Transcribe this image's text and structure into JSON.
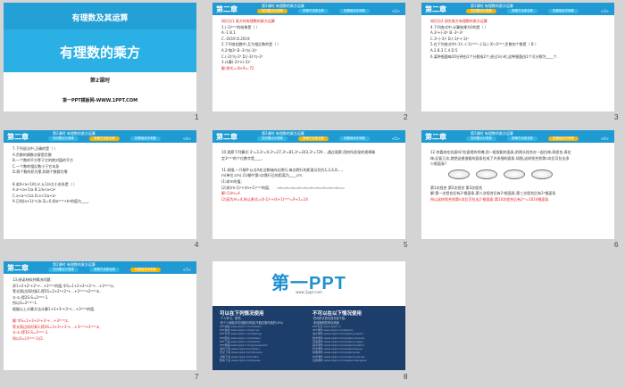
{
  "header": {
    "chapter": "第二章",
    "section": "第2课时 有理数的乘方运算",
    "tabs": [
      "知识要点分类练",
      "规律方法综合练",
      "拓展培优冲刺练"
    ]
  },
  "slides": [
    {
      "number": "1",
      "type": "cover",
      "subtitle": "有理数及其运算",
      "title": "有理数的乘方",
      "lesson": "第2课时",
      "footer": "第一PPT模板网-WWW.1PPT.COM"
    },
    {
      "number": "2",
      "page": "<2>",
      "active_tab": 0,
      "lines": [
        {
          "t": "知识点1  乘方的有理数的乘方运算",
          "red": true
        },
        {
          "t": "1.(-1)²⁰¹⁹的结果是（   ）"
        },
        {
          "t": "A.-1      B.1"
        },
        {
          "t": "C.-2019 D.2019"
        },
        {
          "t": "2.下列各组数中,互为相反数的是（   ）"
        },
        {
          "t": "A.2²和3²            B.-3²与(-3)²"
        },
        {
          "t": "C.(-2)³与-2³   D.(-3)³与-3³"
        },
        {
          "t": "3.计算(-2)³×(-3)²"
        },
        {
          "t": "解:原式=-8×9=-72",
          "red": true
        }
      ]
    },
    {
      "number": "3",
      "page": "<3>",
      "active_tab": 0,
      "lines": [
        {
          "t": "知识点2  研究乘方有理数的乘方运算",
          "red": true
        },
        {
          "t": "4.下列各式中,计算结果为0的是（   ）"
        },
        {
          "t": "A.3²+(-3)²  B.-3²-3²"
        },
        {
          "t": "C.3²-(-3)²  D.(-3)²-(-3)²"
        },
        {
          "t": "5.在下列各式中(-1)²,-(-1)²⁰¹⁹,-|-3|,(-3)²,0²⁰¹⁹,负数的个数是（ B ）"
        },
        {
          "t": "A.2      B.3      C.4      D.5"
        },
        {
          "t": "6.某种细菌每20分钟由1个分裂成2个,经过3小时,这种细菌由1个可分裂为____个."
        }
      ]
    },
    {
      "number": "4",
      "page": "<4>",
      "active_tab": 1,
      "lines": [
        {
          "t": "7.下列说法中,正确的是（   ）"
        },
        {
          "t": "A.负数的偶数次幂是负数"
        },
        {
          "t": "B.一个数的平方等于它的绝对值的平方"
        },
        {
          "t": "C.一个数的相反数小于它本身"
        },
        {
          "t": "D.两个数的积为零,则两个数都为零"
        },
        {
          "t": ""
        },
        {
          "t": "8.若0<a<1时,a²,a,1/a大小关系是（   ）"
        },
        {
          "t": "A.a²<a<1/a            B.1/a<a<a²"
        },
        {
          "t": "C.a<a²<1/a            D.a<1/a<a²"
        },
        {
          "t": "9.已知(a+1)²+|b-2|=0,则a²⁰¹⁹+b³的值为____."
        }
      ]
    },
    {
      "number": "5",
      "page": "<5>",
      "active_tab": 1,
      "lines": [
        {
          "t": "10.观察下列算式:3¹=3,3²=9,3³=27,3⁴=81,3⁵=243,3⁶=729…,通过观察,用你所发现的规律确"
        },
        {
          "t": "定3²⁰¹⁹的个位数字是____."
        },
        {
          "t": ""
        },
        {
          "t": "11.如图,一只蜗牛从点A处沿数轴向右爬行,每次爬行的距离分别为1,2,4,8,…,"
        },
        {
          "t": "m(单位:cm).(1)蜗牛第n次爬行后的距离为____cm."
        },
        {
          "t": "(1)求m的值;"
        },
        {
          "t": "(2)求(m-1)²+(m+1)²⁰¹⁹的值."
        },
        {
          "t": "解:(1)m=4",
          "red": true
        },
        {
          "t": "(2)因为m=4,所以原式=(4-1)²+(4+1)²⁰¹⁹=9+1=14",
          "red": true
        }
      ]
    },
    {
      "number": "6",
      "page": "<6>",
      "active_tab": 2,
      "lines": [
        {
          "t": "12.你喜欢吃拉面吗?拉面馆的师傅,用一根很粗的面条,把两头捏合在一起拉伸,再捏合,再拉"
        },
        {
          "t": "伸,反复几次,就把这根很粗的面条拉成了许多细的面条.如图,这样捏合到第n次后可拉出多"
        },
        {
          "t": "少根面条?"
        },
        {
          "t": ""
        },
        {
          "t": ""
        },
        {
          "t": ""
        },
        {
          "t": "第1次捏合  第2次捏合  第3次捏合"
        },
        {
          "t": "解:第一次捏合后有2¹根面条,第二次捏合后有2²根面条,第三次捏合后有2³根面条"
        },
        {
          "t": "所以这样捏合到第n次后可拉出2ⁿ根面条;第10次捏合后有2¹⁰=1024根面条.",
          "red": true
        }
      ]
    },
    {
      "number": "7",
      "page": "<7>",
      "active_tab": 2,
      "lines": [
        {
          "t": "13.阅读材料并解决问题:"
        },
        {
          "t": "求1+2+2²+2³+…+2²⁰¹⁹的值,令S=1+2+2²+2³+…+2²⁰¹⁹①,"
        },
        {
          "t": "等式两边同时乘2,得2S=2+2²+2³+…+2²⁰¹⁹+2²⁰²⁰②,"
        },
        {
          "t": "②-①,得2S-S=2²⁰²⁰-1."
        },
        {
          "t": "所以S=2²⁰²⁰-1."
        },
        {
          "t": "根据以上计算方法计算1+3+3²+3³+…+3²⁰¹⁹的值."
        },
        {
          "t": ""
        },
        {
          "t": "解:令S=1+3+3²+3³+…+3²⁰¹⁹①,",
          "red": true
        },
        {
          "t": "等式两边同时乘3,得3S=3+3²+3³+…+3²⁰¹⁹+3²⁰²⁰②,",
          "red": true
        },
        {
          "t": "②-①,得3S-S=3²⁰²⁰-1,",
          "red": true
        },
        {
          "t": "所以S=(3²⁰²⁰-1)/2.",
          "red": true
        }
      ]
    },
    {
      "number": "8",
      "type": "ad",
      "logo": "第一PPT",
      "url": "www.1ppt.com",
      "col1": {
        "title": "可以在下列情况使用",
        "desc": [
          "·个人学习、研究;",
          "·在个人网站中引用部分内容(不超过原作品的10%)"
        ],
        "rows": [
          "PPT模板 www.1ppt.com/moban/",
          "PPT素材 www.1ppt.com/sucai/",
          "PPT背景 www.1ppt.com/beijing/",
          "PPT图表 www.1ppt.com/tubiao/",
          "PPT下载 www.1ppt.com/xiazai/",
          "PPT教程 www.1ppt.com/powerpoint/",
          "资料下载 www.1ppt.com/ziliao/",
          "范文下载 www.1ppt.com/fanwen/",
          "试卷下载 www.1ppt.com/shiti/",
          "教案下载 www.1ppt.com/jiaoan/"
        ]
      },
      "col2": {
        "title": "不可以在以下情况使用",
        "desc": [
          "·任何形式的在线付费下载;",
          "·未经授权的商业用途."
        ],
        "rows": [
          "PPT论坛 www.1ppt.cn",
          "PPT课件 www.1ppt.com/kejian/",
          "语文课件 www.1ppt.com/kejian/yuwen/",
          "数学课件 www.1ppt.com/kejian/shuxue/",
          "英语课件 www.1ppt.com/kejian/yingyu/",
          "美术课件 www.1ppt.com/kejian/meishu/",
          "科学课件 www.1ppt.com/kejian/kexue/",
          "物理课件 www.1ppt.com/kejian/wuli/",
          "化学课件 www.1ppt.com/kejian/huaxue/",
          "生物课件 www.1ppt.com/kejian/shengwu/"
        ]
      }
    }
  ]
}
